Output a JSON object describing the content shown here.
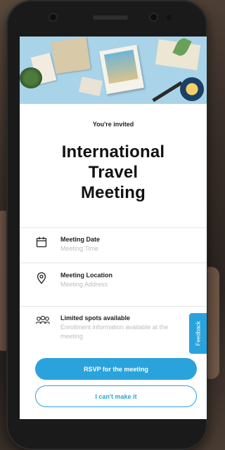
{
  "invitation": {
    "eyebrow": "You're invited",
    "title_lines": [
      "International",
      "Travel",
      "Meeting"
    ]
  },
  "details": {
    "date": {
      "label": "Meeting Date",
      "value": "Meeting Time",
      "icon": "calendar-icon"
    },
    "location": {
      "label": "Meeting Location",
      "value": "Meeting Address",
      "icon": "location-pin-icon"
    },
    "spots": {
      "label": "Limited spots available",
      "value": "Enrollment information available at the meeting",
      "icon": "people-group-icon"
    }
  },
  "feedback_tab": {
    "label": "Feedback"
  },
  "actions": {
    "rsvp": "RSVP for the meeting",
    "decline": "I can't make it"
  },
  "colors": {
    "accent": "#2aa3dd",
    "text_primary": "#111111",
    "text_muted": "#bdbdbd"
  }
}
